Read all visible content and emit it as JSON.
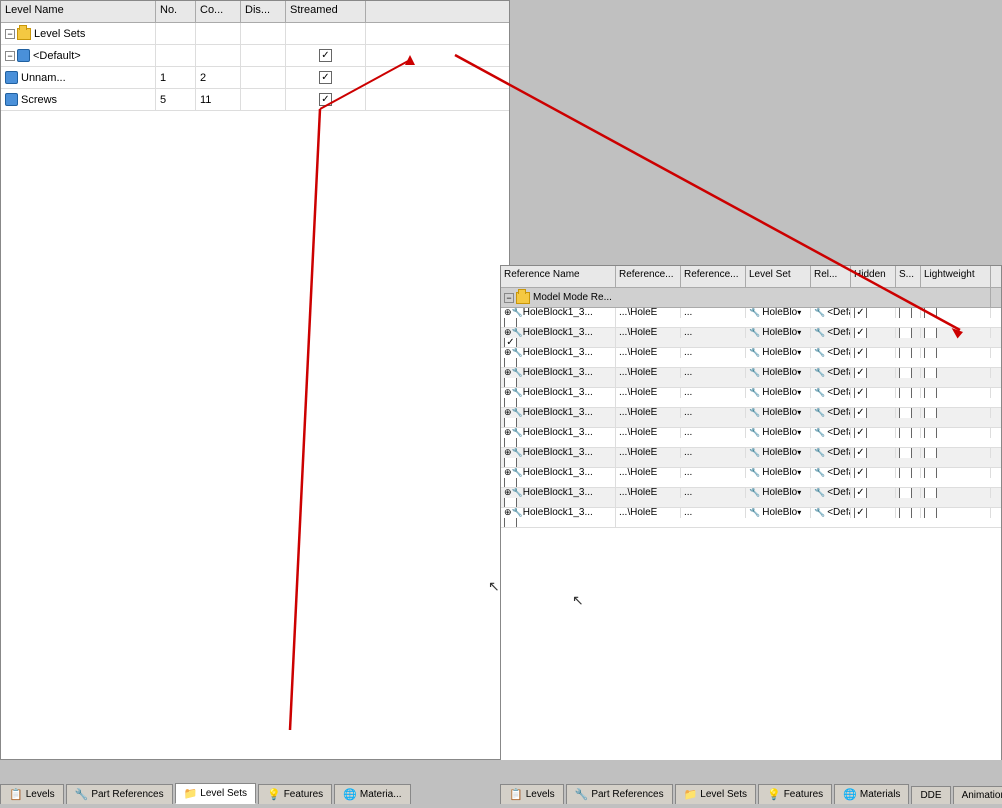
{
  "leftPanel": {
    "columns": [
      "Level Name",
      "No.",
      "Co...",
      "Dis...",
      "Streamed"
    ],
    "rows": [
      {
        "name": "Level Sets",
        "indent": 0,
        "type": "expand-folder",
        "no": "",
        "co": "",
        "dis": "",
        "streamed_cb": false,
        "expanded": true
      },
      {
        "name": "<Default>",
        "indent": 1,
        "type": "folder",
        "no": "",
        "co": "",
        "dis": "",
        "streamed_cb": true,
        "expanded": true
      },
      {
        "name": "Unnam...",
        "indent": 2,
        "type": "level",
        "no": "1",
        "co": "2",
        "dis": "",
        "streamed_cb": true,
        "expanded": false
      },
      {
        "name": "Screws",
        "indent": 2,
        "type": "level",
        "no": "5",
        "co": "11",
        "dis": "",
        "streamed_cb": true,
        "expanded": false
      }
    ]
  },
  "rightPanel": {
    "columns": [
      "Reference Name",
      "Reference...",
      "Reference...",
      "Level Set",
      "Rel...",
      "Hidden",
      "S...",
      "Lightweight"
    ],
    "groupRow": "Model Mode Re...",
    "rows": [
      {
        "name": "HoleBlock1_3...",
        "ref1": "...\\HoleE",
        "ref2": "...",
        "ref3": "HoleBlo",
        "levelSet": "<Defaul",
        "rel": true,
        "hidden": false,
        "s": false,
        "lw": false
      },
      {
        "name": "HoleBlock1_3...",
        "ref1": "...\\HoleE",
        "ref2": "...",
        "ref3": "HoleBlo",
        "levelSet": "<Defaul",
        "rel": true,
        "hidden": false,
        "s": false,
        "lw": true
      },
      {
        "name": "HoleBlock1_3...",
        "ref1": "...\\HoleE",
        "ref2": "...",
        "ref3": "HoleBlo",
        "levelSet": "<Defaul",
        "rel": true,
        "hidden": false,
        "s": false,
        "lw": false
      },
      {
        "name": "HoleBlock1_3...",
        "ref1": "...\\HoleE",
        "ref2": "...",
        "ref3": "HoleBlo",
        "levelSet": "<Defaul",
        "rel": true,
        "hidden": false,
        "s": false,
        "lw": false
      },
      {
        "name": "HoleBlock1_3...",
        "ref1": "...\\HoleE",
        "ref2": "...",
        "ref3": "HoleBlo",
        "levelSet": "<Defaul",
        "rel": true,
        "hidden": false,
        "s": false,
        "lw": false
      },
      {
        "name": "HoleBlock1_3...",
        "ref1": "...\\HoleE",
        "ref2": "...",
        "ref3": "HoleBlo",
        "levelSet": "<Defaul",
        "rel": true,
        "hidden": false,
        "s": false,
        "lw": false
      },
      {
        "name": "HoleBlock1_3...",
        "ref1": "...\\HoleE",
        "ref2": "...",
        "ref3": "HoleBlo",
        "levelSet": "<Defaul",
        "rel": true,
        "hidden": false,
        "s": false,
        "lw": false
      },
      {
        "name": "HoleBlock1_3...",
        "ref1": "...\\HoleE",
        "ref2": "...",
        "ref3": "HoleBlo",
        "levelSet": "<Defaul",
        "rel": true,
        "hidden": false,
        "s": false,
        "lw": false
      },
      {
        "name": "HoleBlock1_3...",
        "ref1": "...\\HoleE",
        "ref2": "...",
        "ref3": "HoleBlo",
        "levelSet": "<Defaul",
        "rel": true,
        "hidden": false,
        "s": false,
        "lw": false
      },
      {
        "name": "HoleBlock1_3...",
        "ref1": "...\\HoleE",
        "ref2": "...",
        "ref3": "HoleBlo",
        "levelSet": "<Defaul",
        "rel": true,
        "hidden": false,
        "s": false,
        "lw": false
      },
      {
        "name": "HoleBlock1_3...",
        "ref1": "...\\HoleE",
        "ref2": "...",
        "ref3": "HoleBlo",
        "levelSet": "<Defaul",
        "rel": true,
        "hidden": false,
        "s": false,
        "lw": false
      }
    ]
  },
  "leftTabs": [
    {
      "label": "Levels",
      "icon": "levels",
      "active": false
    },
    {
      "label": "Part References",
      "icon": "parts",
      "active": false
    },
    {
      "label": "Level Sets",
      "icon": "levelsets",
      "active": true
    },
    {
      "label": "Features",
      "icon": "features",
      "active": false
    },
    {
      "label": "Materia...",
      "icon": "materials",
      "active": false
    }
  ],
  "rightTabs": [
    {
      "label": "Levels",
      "icon": "levels",
      "active": false
    },
    {
      "label": "Part References",
      "icon": "parts",
      "active": false
    },
    {
      "label": "Level Sets",
      "icon": "levelsets",
      "active": false
    },
    {
      "label": "Features",
      "icon": "features",
      "active": false
    },
    {
      "label": "Materials",
      "icon": "materials",
      "active": false
    },
    {
      "label": "DDE",
      "icon": "dde",
      "active": false
    },
    {
      "label": "Animation",
      "icon": "animation",
      "active": false
    }
  ]
}
